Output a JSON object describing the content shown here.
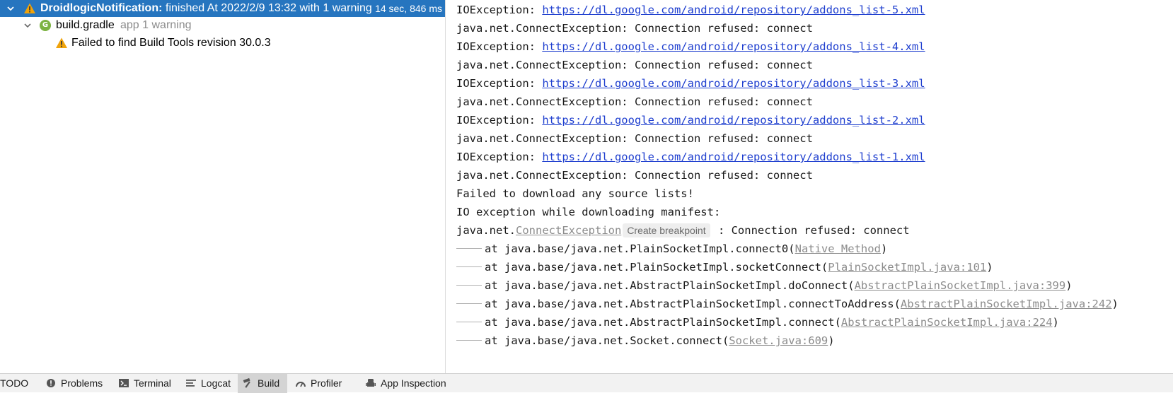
{
  "tree": {
    "root": {
      "name": "DroidlogicNotification:",
      "status": "finished At 2022/2/9 13:32 with 1 warning",
      "duration": "14 sec, 846 ms"
    },
    "child": {
      "name": "build.gradle",
      "suffix": "app 1 warning"
    },
    "warning": {
      "text": "Failed to find Build Tools revision 30.0.3"
    }
  },
  "console": {
    "lines": [
      {
        "prefix": "IOException: ",
        "url": "https://dl.google.com/android/repository/addons_list-5.xml"
      },
      {
        "text": "java.net.ConnectException: Connection refused: connect"
      },
      {
        "prefix": "IOException: ",
        "url": "https://dl.google.com/android/repository/addons_list-4.xml"
      },
      {
        "text": "java.net.ConnectException: Connection refused: connect"
      },
      {
        "prefix": "IOException: ",
        "url": "https://dl.google.com/android/repository/addons_list-3.xml"
      },
      {
        "text": "java.net.ConnectException: Connection refused: connect"
      },
      {
        "prefix": "IOException: ",
        "url": "https://dl.google.com/android/repository/addons_list-2.xml"
      },
      {
        "text": "java.net.ConnectException: Connection refused: connect"
      },
      {
        "prefix": "IOException: ",
        "url": "https://dl.google.com/android/repository/addons_list-1.xml"
      },
      {
        "text": "java.net.ConnectException: Connection refused: connect"
      },
      {
        "text": "Failed to download any source lists!"
      },
      {
        "text": "IO exception while downloading manifest:"
      }
    ],
    "exception": {
      "pkg": "java.net.",
      "cls": "ConnectException",
      "breakpoint": "Create breakpoint",
      "rest": " : Connection refused: connect"
    },
    "stack": [
      {
        "call": "at java.base/java.net.PlainSocketImpl.connect0(",
        "ref": "Native Method",
        "end": ")"
      },
      {
        "call": "at java.base/java.net.PlainSocketImpl.socketConnect(",
        "ref": "PlainSocketImpl.java:101",
        "end": ")"
      },
      {
        "call": "at java.base/java.net.AbstractPlainSocketImpl.doConnect(",
        "ref": "AbstractPlainSocketImpl.java:399",
        "end": ")"
      },
      {
        "call": "at java.base/java.net.AbstractPlainSocketImpl.connectToAddress(",
        "ref": "AbstractPlainSocketImpl.java:242",
        "end": ")"
      },
      {
        "call": "at java.base/java.net.AbstractPlainSocketImpl.connect(",
        "ref": "AbstractPlainSocketImpl.java:224",
        "end": ")"
      },
      {
        "call": "at java.base/java.net.Socket.connect(",
        "ref": "Socket.java:609",
        "end": ")"
      }
    ]
  },
  "toolbar": {
    "items": [
      {
        "label": "TODO",
        "icon": "none"
      },
      {
        "label": "Problems",
        "icon": "problems-icon"
      },
      {
        "label": "Terminal",
        "icon": "terminal-icon"
      },
      {
        "label": "Logcat",
        "icon": "logcat-icon"
      },
      {
        "label": "Build",
        "icon": "hammer-icon",
        "active": true
      },
      {
        "label": "Profiler",
        "icon": "gauge-icon"
      },
      {
        "label": "App Inspection",
        "icon": "inspection-icon"
      }
    ]
  },
  "colors": {
    "selection": "#2675bf",
    "link": "#1f3fcf",
    "warning": "#f0a30a",
    "gradle": "#7cb342"
  }
}
